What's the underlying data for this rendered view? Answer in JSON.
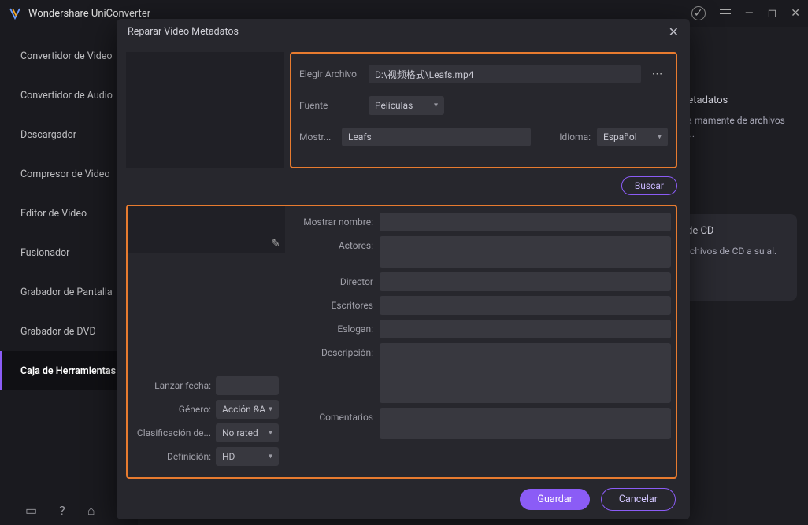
{
  "app": {
    "title": "Wondershare UniConverter"
  },
  "sidebar": {
    "items": [
      {
        "label": "Convertidor de Video"
      },
      {
        "label": "Convertidor de Audio"
      },
      {
        "label": "Descargador"
      },
      {
        "label": "Compresor de Video"
      },
      {
        "label": "Editor de Video"
      },
      {
        "label": "Fusionador"
      },
      {
        "label": "Grabador de Pantalla"
      },
      {
        "label": "Grabador de DVD"
      },
      {
        "label": "Caja de Herramientas"
      }
    ],
    "active_index": 8
  },
  "background": {
    "panel1": {
      "title": "Metadatos",
      "body": "ara\nmamente\nde archivos m..."
    },
    "panel2": {
      "title": "de CD",
      "body": "rchivos de\nCD a su\nal."
    }
  },
  "modal": {
    "title": "Reparar Video Metadatos",
    "upper": {
      "choose_file_label": "Elegir Archivo",
      "file_path": "D:\\视频格式\\Leafs.mp4",
      "source_label": "Fuente",
      "source_value": "Películas",
      "showname_label": "Mostr...",
      "showname_value": "Leafs",
      "language_label": "Idioma:",
      "language_value": "Español",
      "search_label": "Buscar"
    },
    "lower": {
      "display_name_label": "Mostrar nombre:",
      "actors_label": "Actores:",
      "director_label": "Director",
      "writers_label": "Escritores",
      "tagline_label": "Eslogan:",
      "description_label": "Descripción:",
      "comments_label": "Comentarios",
      "display_name_value": "",
      "actors_value": "",
      "director_value": "",
      "writers_value": "",
      "tagline_value": "",
      "description_value": "",
      "comments_value": ""
    },
    "left_meta": {
      "release_label": "Lanzar fecha:",
      "release_value": "",
      "genre_label": "Género:",
      "genre_value": "Acción &A",
      "rating_label": "Clasificación de...",
      "rating_value": "No rated",
      "definition_label": "Definición:",
      "definition_value": "HD"
    },
    "footer": {
      "save": "Guardar",
      "cancel": "Cancelar"
    }
  }
}
